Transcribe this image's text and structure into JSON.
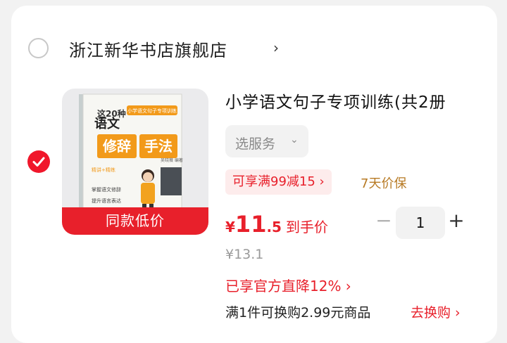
{
  "shop": {
    "name": "浙江新华书店旗舰店",
    "chevron": "›"
  },
  "product": {
    "image_tag": "同款低价",
    "title": "小学语文句子专项训练(共2册",
    "service_label": "选服务",
    "service_chevron": "⌄",
    "promo": "可享满99减15 ›",
    "price_protect": "7天价保",
    "price_symbol": "¥",
    "price_int": "11",
    "price_dec": ".5",
    "price_suffix": "到手价",
    "original_price": "¥13.1",
    "official_discount": "已享官方直降12% ›",
    "exchange_text": "满1件可换购2.99元商品",
    "exchange_link": "去换购 ›",
    "book": {
      "series": "小学语文句子专项训练",
      "badge": "这20种",
      "subject": "语文",
      "topic_1": "修辞",
      "topic_2": "手法",
      "bullets": [
        "精讲+精练",
        "掌握语文修辞",
        "提升语言表达"
      ],
      "author": "吴晓薇 编著"
    }
  },
  "quantity": {
    "minus": "−",
    "value": "1",
    "plus": "+"
  },
  "colors": {
    "accent_red": "#e8202b",
    "price_protect_gold": "#b77a24",
    "book_orange": "#f29a1a"
  }
}
